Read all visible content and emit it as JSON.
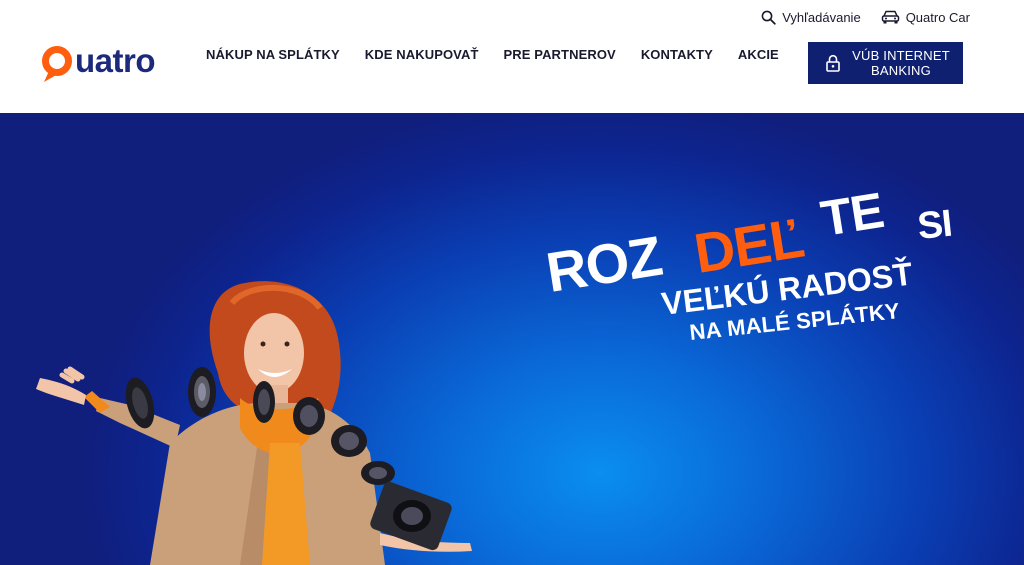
{
  "header": {
    "logo_text": "uatro",
    "logo_alt": "Quatro",
    "nav": [
      {
        "label": "NÁKUP NA SPLÁTKY"
      },
      {
        "label": "KDE NAKUPOVAŤ"
      },
      {
        "label": "PRE PARTNEROV"
      },
      {
        "label": "KONTAKTY"
      },
      {
        "label": "AKCIE"
      }
    ],
    "utility": {
      "search_label": "Vyhľadávanie",
      "car_label": "Quatro Car"
    },
    "bank_button": {
      "line1": "VÚB INTERNET",
      "line2": "BANKING"
    }
  },
  "hero": {
    "headline": {
      "part1": "ROZ",
      "part2": "DEĽ",
      "part3": "TE",
      "part4": "SI",
      "line2": "VEĽKÚ RADOSŤ",
      "line3": "NA MALÉ SPLÁTKY"
    }
  },
  "colors": {
    "brand_navy": "#1b2a7a",
    "brand_orange": "#ff5e0e",
    "button_navy": "#0f2071",
    "hero_blue": "#0a6ad8"
  },
  "icons": [
    "search-icon",
    "car-icon",
    "lock-icon"
  ]
}
